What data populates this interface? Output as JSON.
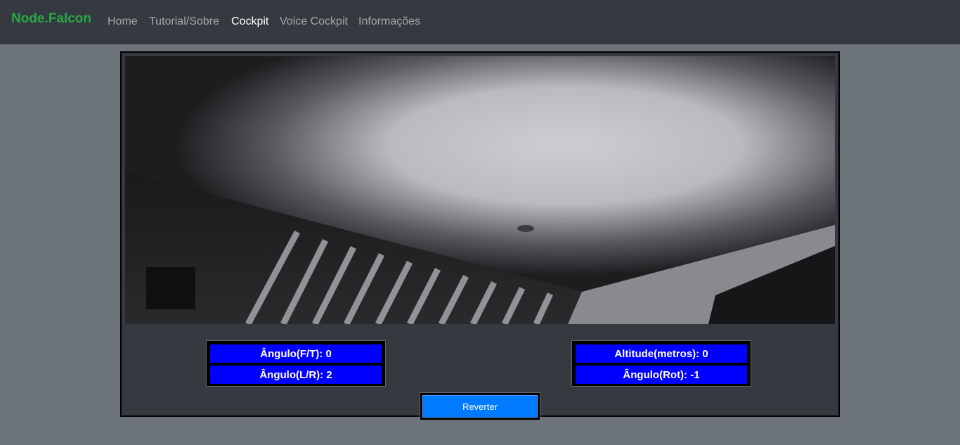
{
  "navbar": {
    "brand": "Node.Falcon",
    "links": [
      {
        "label": "Home",
        "active": false
      },
      {
        "label": "Tutorial/Sobre",
        "active": false
      },
      {
        "label": "Cockpit",
        "active": true
      },
      {
        "label": "Voice Cockpit",
        "active": false
      },
      {
        "label": "Informações",
        "active": false
      }
    ]
  },
  "telemetry": {
    "angle_ft": "Ângulo(F/T): 0",
    "angle_lr": "Ângulo(L/R): 2",
    "altitude": "Altitude(metros): 0",
    "angle_rot": "Ângulo(Rot): -1"
  },
  "controls": {
    "revert_label": "Reverter"
  },
  "colors": {
    "brand": "#28a745",
    "navbar_bg": "#343a40",
    "page_bg": "#6c737b",
    "readout_bg": "#0000ff",
    "button_bg": "#007bff"
  }
}
